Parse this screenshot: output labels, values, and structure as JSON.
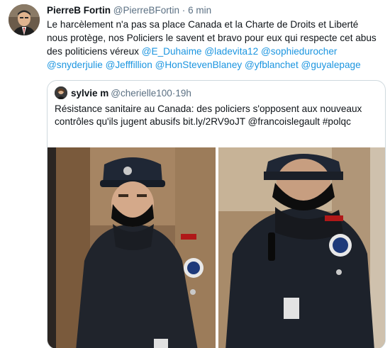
{
  "tweet": {
    "display_name": "PierreB Fortin",
    "handle": "@PierreBFortin",
    "separator": "·",
    "time": "6 min",
    "text_plain": "Le harcèlement n'a pas sa place Canada et la Charte de Droits et Liberté nous protège, nos Policiers le savent et bravo pour eux qui respecte cet abus des politiciens véreux ",
    "mentions": [
      "@E_Duhaime",
      "@ladevita12",
      "@sophiedurocher",
      "@snyderjulie",
      "@Jefffillion",
      "@HonStevenBlaney",
      "@yfblanchet",
      "@guyalepage"
    ]
  },
  "quoted_tweet": {
    "display_name": "sylvie m",
    "handle": "@cherielle100",
    "separator": "·",
    "time": "19h",
    "text": "Résistance sanitaire au Canada: des policiers s'opposent aux nouveaux contrôles qu'ils jugent abusifs bit.ly/2RV9oJT @francoislegault #polqc"
  },
  "colors": {
    "text": "#0f1419",
    "secondary": "#5b7083",
    "link": "#1b95e0",
    "border": "#cfd9de"
  }
}
